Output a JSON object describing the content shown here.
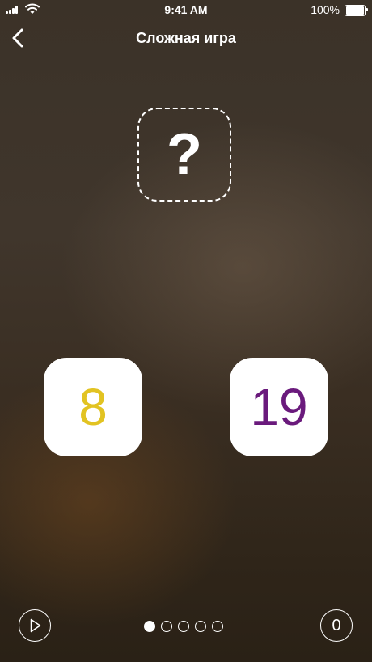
{
  "status_bar": {
    "time": "9:41 AM",
    "battery_percent": "100%",
    "icons": [
      "signal-icon",
      "wifi-icon",
      "battery-icon"
    ]
  },
  "nav": {
    "title": "Сложная игра",
    "back_icon": "chevron-left-icon"
  },
  "question": {
    "symbol": "?"
  },
  "tiles": [
    {
      "value": "8",
      "color": "#e2c322"
    },
    {
      "value": "19",
      "color": "#6a1a7c"
    }
  ],
  "controls": {
    "play_icon": "play-icon",
    "score": "0",
    "page_count": 5,
    "active_page": 1
  }
}
